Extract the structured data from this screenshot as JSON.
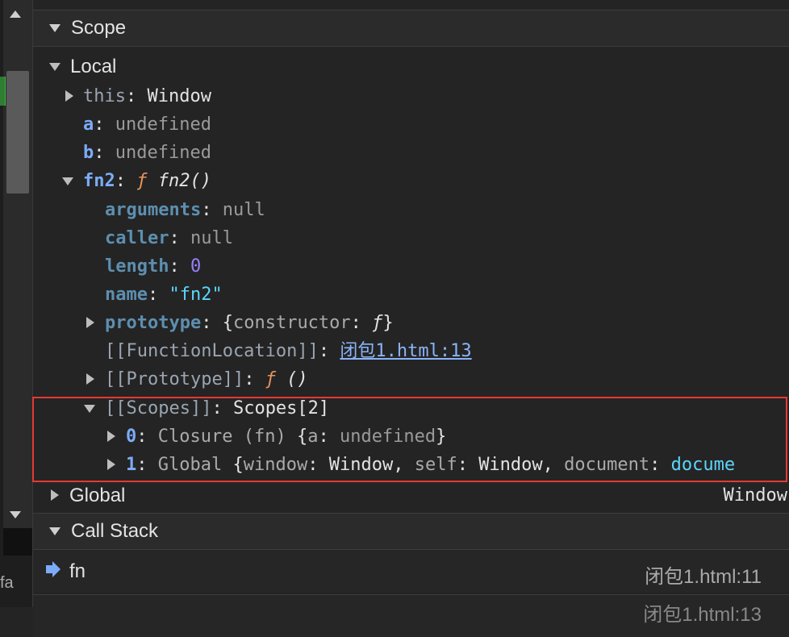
{
  "scope": {
    "header": "Scope",
    "local": {
      "label": "Local",
      "this": {
        "key": "this",
        "value": "Window"
      },
      "a": {
        "key": "a",
        "value": "undefined"
      },
      "b": {
        "key": "b",
        "value": "undefined"
      },
      "fn2": {
        "key": "fn2",
        "f": "ƒ",
        "sig": "fn2()",
        "arguments": {
          "key": "arguments",
          "value": "null"
        },
        "caller": {
          "key": "caller",
          "value": "null"
        },
        "length": {
          "key": "length",
          "value": "0"
        },
        "name": {
          "key": "name",
          "value": "\"fn2\""
        },
        "prototype": {
          "key": "prototype",
          "open": "{",
          "inner_key": "constructor",
          "inner_value": "ƒ",
          "close": "}"
        },
        "function_location": {
          "key": "[[FunctionLocation]]",
          "value": "闭包1.html:13"
        },
        "proto": {
          "key": "[[Prototype]]",
          "f": "ƒ",
          "value": "()"
        },
        "scopes": {
          "key": "[[Scopes]]",
          "value": "Scopes[2]",
          "items": [
            {
              "index": "0",
              "type": "Closure (fn)",
              "open": "{",
              "k1": "a",
              "v1": "undefined",
              "close": "}"
            },
            {
              "index": "1",
              "type": "Global",
              "open": "{",
              "k1": "window",
              "v1": "Window",
              "sep1": ",",
              "k2": "self",
              "v2": "Window",
              "sep2": ",",
              "k3": "document",
              "v3": "docume"
            }
          ]
        }
      }
    },
    "global": {
      "label": "Global",
      "value": "Window"
    }
  },
  "call_stack": {
    "header": "Call Stack",
    "frames": [
      {
        "name": "fn",
        "location": "闭包1.html:11"
      },
      {
        "name": "",
        "location": "闭包1.html:13"
      }
    ]
  },
  "left_panel": {
    "text": "fa"
  },
  "colors": {
    "highlight_box": "#e53935",
    "accent": "#7cacf8"
  }
}
